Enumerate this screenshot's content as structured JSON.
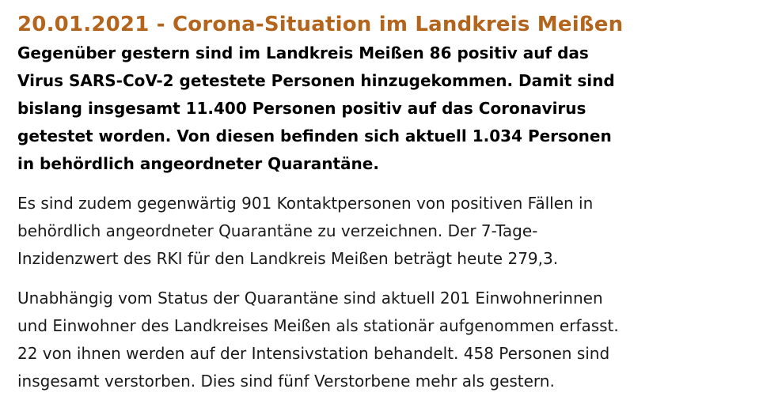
{
  "article": {
    "headline": "20.01.2021 - Corona-Situation im Landkreis Meißen",
    "lead_lines": [
      "Gegenüber gestern sind im Landkreis Meißen 86 positiv auf das",
      "Virus SARS-CoV-2 getestete Personen hinzugekommen. Damit sind",
      "bislang insgesamt 11.400 Personen positiv auf das Coronavirus",
      "getestet worden. Von diesen befinden sich aktuell 1.034 Personen",
      "in behördlich angeordneter Quarantäne."
    ],
    "paragraph1_lines": [
      "Es sind zudem gegenwärtig 901 Kontaktpersonen von positiven Fällen in",
      "behördlich angeordneter Quarantäne zu verzeichnen. Der 7-Tage-",
      "Inzidenzwert des RKI für den Landkreis Meißen beträgt heute 279,3."
    ],
    "paragraph2_lines": [
      "Unabhängig vom Status der Quarantäne sind aktuell 201 Einwohnerinnen",
      "und Einwohner des Landkreises Meißen als stationär aufgenommen erfasst.",
      "22 von ihnen werden auf der Intensivstation behandelt. 458 Personen sind",
      "insgesamt verstorben. Dies sind fünf Verstorbene mehr als gestern."
    ]
  },
  "colors": {
    "headline": "#b3651d",
    "text": "#000000"
  }
}
